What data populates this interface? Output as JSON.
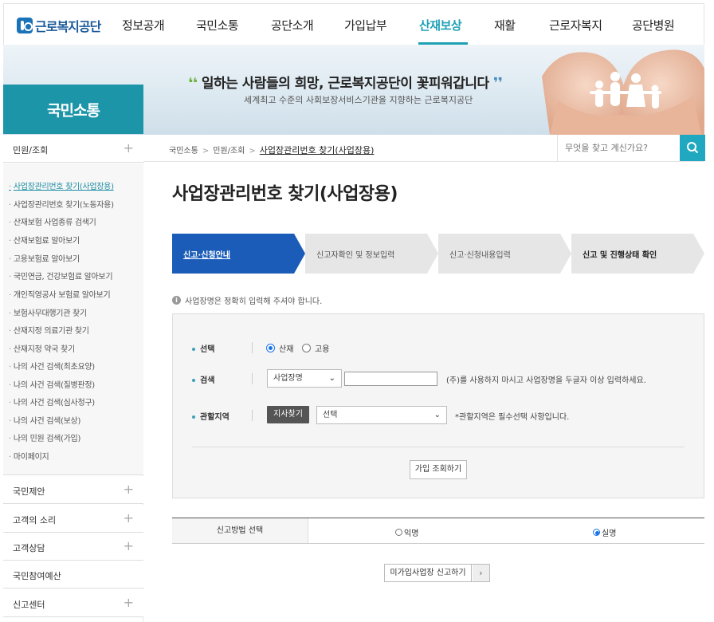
{
  "header": {
    "logo_text": "근로복지공단",
    "nav": [
      "정보공개",
      "국민소통",
      "공단소개",
      "가입납부",
      "산재보상",
      "재활",
      "근로자복지",
      "공단병원"
    ],
    "active_nav": "산재보상"
  },
  "hero": {
    "slogan": "일하는 사람들의 희망, 근로복지공단이 꽃피워갑니다",
    "subtitle": "세계최고 수준의 사회보장서비스기관을 지향하는 근로복지공단"
  },
  "sidebar": {
    "section_title": "국민소통",
    "groups": [
      {
        "label": "민원/조회",
        "expandable": true
      },
      {
        "label": "국민제안",
        "expandable": true
      },
      {
        "label": "고객의 소리",
        "expandable": true
      },
      {
        "label": "고객상담",
        "expandable": true
      },
      {
        "label": "국민참여예산",
        "expandable": false
      },
      {
        "label": "신고센터",
        "expandable": true
      }
    ],
    "sub_items": [
      "사업장관리번호 찾기(사업장용)",
      "사업장관리번호 찾기(노동자용)",
      "산재보험 사업종류 검색기",
      "산재보험료 알아보기",
      "고용보험료 알아보기",
      "국민연금, 건강보험료 알아보기",
      "개인직영공사 보험료 알아보기",
      "보험사무대행기관 찾기",
      "산재지정 의료기관 찾기",
      "산재지정 약국 찾기",
      "나의 사건 검색(최초요양)",
      "나의 사건 검색(질병판정)",
      "나의 사건 검색(심사청구)",
      "나의 사건 검색(보상)",
      "나의 민원 검색(가입)",
      "마이페이지"
    ],
    "active_sub": 0
  },
  "breadcrumb": {
    "items": [
      "국민소통",
      "민원/조회"
    ],
    "current": "사업장관리번호 찾기(사업장용)",
    "separator": ">"
  },
  "search": {
    "placeholder": "무엇을 찾고 계신가요?"
  },
  "page_title": "사업장관리번호 찾기(사업장용)",
  "steps": [
    {
      "label": "신고·신청안내",
      "state": "current"
    },
    {
      "label": "신고자확인 및 정보입력",
      "state": "todo"
    },
    {
      "label": "신고·신청내용입력",
      "state": "todo"
    },
    {
      "label": "신고 및 진행상태 확인",
      "state": "bold"
    }
  ],
  "notice": "사업장명은 정확히 입력해 주셔야 합니다.",
  "form": {
    "select_label": "선택",
    "insurance_options": [
      "산재",
      "고용"
    ],
    "insurance_selected": "산재",
    "search_label": "검색",
    "search_type_value": "사업장명",
    "search_hint": "(주)를 사용하지 마시고 사업장명을 두글자 이상 입력하세요.",
    "region_label": "관할지역",
    "branch_button": "지사찾기",
    "region_value": "선택",
    "region_hint": "*관할지역은 필수선택 사항입니다.",
    "check_button": "가입 조회하기"
  },
  "report_method": {
    "label": "신고방법 선택",
    "options": [
      "익명",
      "실명"
    ],
    "selected": "실명"
  },
  "report_button": "미가입사업장 신고하기",
  "colors": {
    "accent": "#1fa1b4",
    "step_active": "#1a5cb8",
    "step_inactive": "#e6e6e6",
    "section_box": "#1d95a8"
  }
}
